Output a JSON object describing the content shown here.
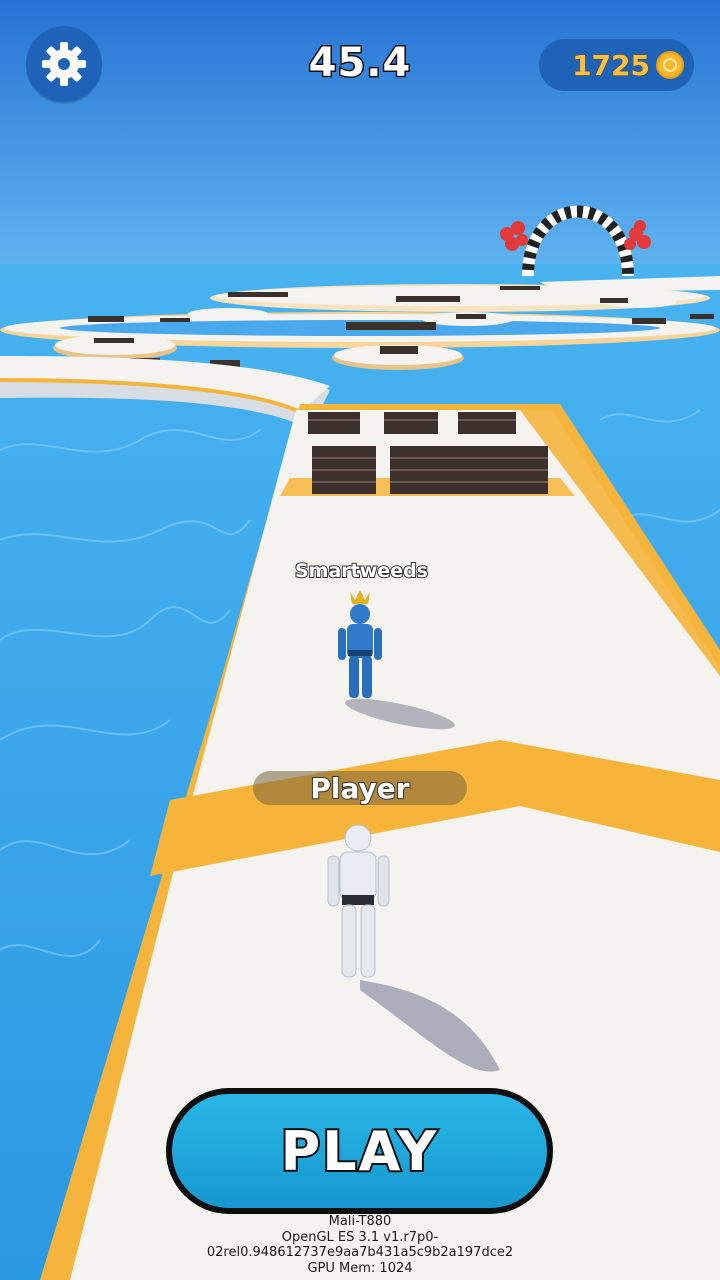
{
  "hud": {
    "timer": "45.4",
    "coins": "1725",
    "settings_icon": "gear-icon",
    "coin_icon": "coin-icon"
  },
  "characters": {
    "rival_name": "Smartweeds",
    "player_name": "Player"
  },
  "play_button": {
    "label": "PLAY"
  },
  "debug": {
    "gpu": "Mali-T880",
    "gl_version": "OpenGL ES 3.1 v1.r7p0-",
    "build": "02rel0.948612737e9aa7b431a5c9b2a197dce2",
    "gpu_mem": "GPU Mem: 1024"
  },
  "colors": {
    "sky": "#2b86d8",
    "water": "#3aa4ea",
    "track": "#f4f3ef",
    "track_edge": "#f5b53c",
    "hud_pill": "#1e63b8",
    "play_button": "#1fa6dc",
    "rival": "#2e79c8",
    "player": "#e9edf3"
  }
}
